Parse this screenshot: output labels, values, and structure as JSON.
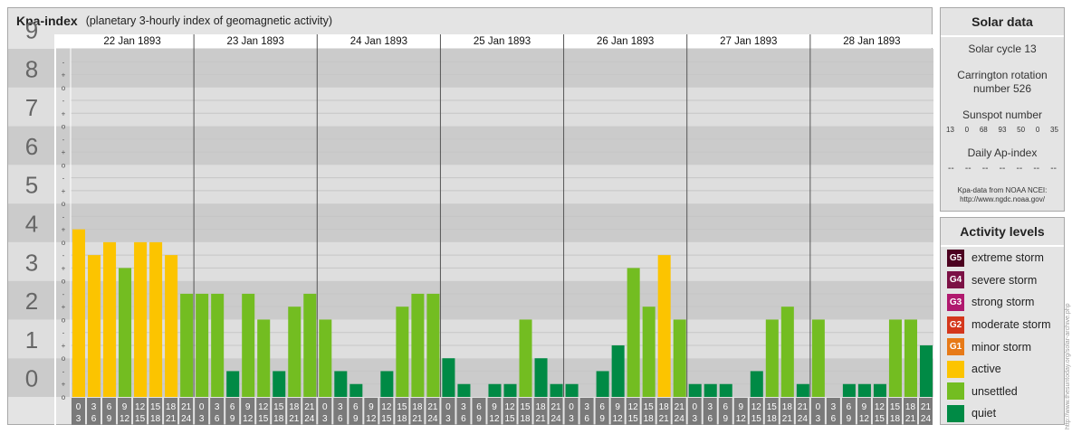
{
  "header": {
    "title": "Kpa-index",
    "subtitle": "(planetary 3-hourly index of geomagnetic activity)"
  },
  "chart_data": {
    "type": "bar",
    "title": "Kpa-index",
    "subtitle": "(planetary 3-hourly index of geomagnetic activity)",
    "ylim": [
      0,
      9
    ],
    "y_ticks": [
      "0",
      "1",
      "2",
      "3",
      "4",
      "5",
      "6",
      "7",
      "8",
      "9"
    ],
    "minor_tick_labels": [
      "o",
      "+",
      "-"
    ],
    "days": [
      "22 Jan 1893",
      "23 Jan 1893",
      "24 Jan 1893",
      "25 Jan 1893",
      "26 Jan 1893",
      "27 Jan 1893",
      "28 Jan 1893"
    ],
    "interval_starts": [
      "0",
      "3",
      "6",
      "9",
      "12",
      "15",
      "18",
      "21"
    ],
    "interval_ends": [
      "3",
      "6",
      "9",
      "12",
      "15",
      "18",
      "21",
      "24"
    ],
    "values": [
      [
        4.333,
        3.667,
        4.0,
        3.333,
        4.0,
        4.0,
        3.667,
        2.667
      ],
      [
        2.667,
        2.667,
        0.667,
        2.667,
        2.0,
        0.667,
        2.333,
        2.667
      ],
      [
        2.0,
        0.667,
        0.333,
        0.0,
        0.667,
        2.333,
        2.667,
        2.667
      ],
      [
        1.0,
        0.333,
        0.0,
        0.333,
        0.333,
        2.0,
        1.0,
        0.333
      ],
      [
        0.333,
        0.0,
        0.667,
        1.333,
        3.333,
        2.333,
        3.667,
        2.0
      ],
      [
        0.333,
        0.333,
        0.333,
        0.0,
        0.667,
        2.0,
        2.333,
        0.333
      ],
      [
        2.0,
        0.0,
        0.333,
        0.333,
        0.333,
        2.0,
        2.0,
        1.333
      ]
    ],
    "level_thresholds": {
      "unsettled": 1.5,
      "active": 3.5
    },
    "colors": {
      "quiet": "#008a45",
      "unsettled": "#73bd21",
      "active": "#fcc400",
      "band_dark": "#cbcbcb",
      "band_light": "#dedede",
      "axis_cell": "#7a7a7a",
      "axis_number": "#666666",
      "day_line": "#555555"
    },
    "grid": true,
    "legend": "right"
  },
  "solar": {
    "title": "Solar data",
    "cycle": "Solar cycle 13",
    "carrington_1": "Carrington rotation",
    "carrington_2": "number 526",
    "sunspot_label": "Sunspot number",
    "sunspot_values": [
      "13",
      "0",
      "68",
      "93",
      "50",
      "0",
      "35"
    ],
    "ap_label": "Daily Ap-index",
    "ap_values": [
      "--",
      "--",
      "--",
      "--",
      "--",
      "--",
      "--"
    ],
    "source_1": "Kpa-data from NOAA NCEI:",
    "source_2": "http://www.ngdc.noaa.gov/"
  },
  "levels": {
    "title": "Activity levels",
    "items": [
      {
        "code": "G5",
        "label": "extreme storm",
        "color": "#4c0220"
      },
      {
        "code": "G4",
        "label": "severe storm",
        "color": "#7b1145"
      },
      {
        "code": "G3",
        "label": "strong storm",
        "color": "#b0196e"
      },
      {
        "code": "G2",
        "label": "moderate storm",
        "color": "#d4371c"
      },
      {
        "code": "G1",
        "label": "minor storm",
        "color": "#e77a18"
      },
      {
        "code": "",
        "label": "active",
        "color": "#fcc400"
      },
      {
        "code": "",
        "label": "unsettled",
        "color": "#73bd21"
      },
      {
        "code": "",
        "label": "quiet",
        "color": "#008a45"
      }
    ]
  },
  "watermark": "http://www.thesuntoday.org/solar-archive.php"
}
